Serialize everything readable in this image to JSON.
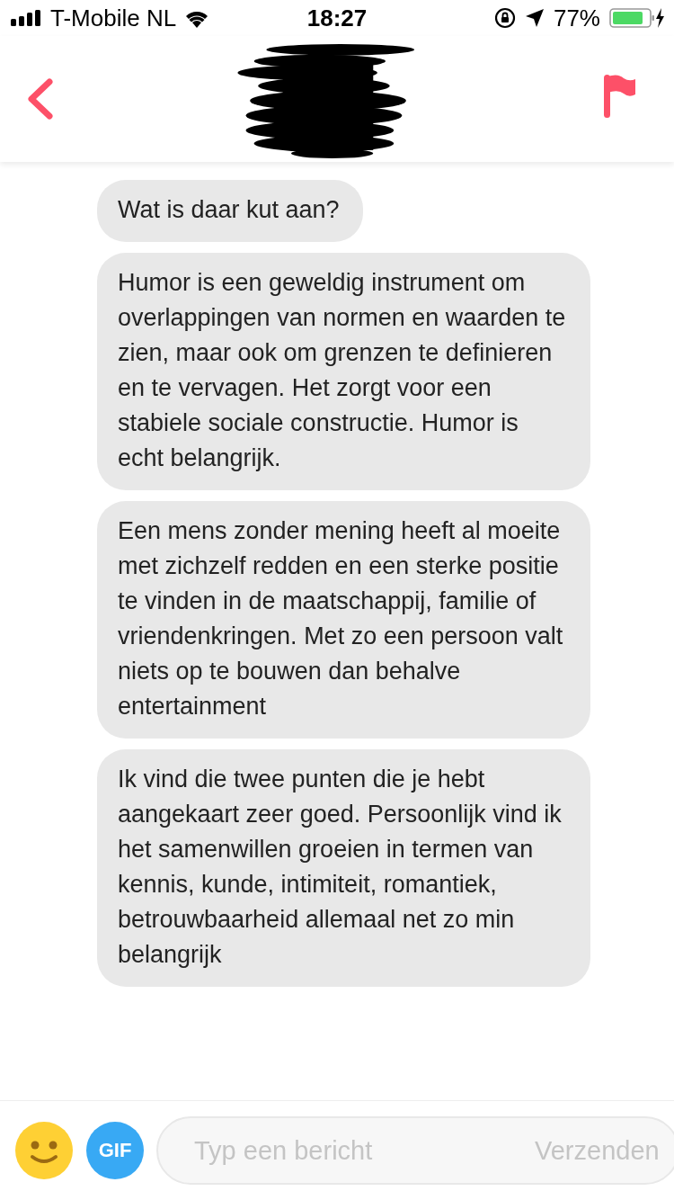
{
  "status_bar": {
    "carrier": "T-Mobile NL",
    "time": "18:27",
    "battery_percent": "77%"
  },
  "messages": [
    {
      "text": "Wat is daar kut aan?"
    },
    {
      "text": "Humor is een geweldig instrument om overlappingen van normen en waarden te zien, maar ook om grenzen te definieren en te vervagen. Het zorgt voor een stabiele sociale constructie. Humor is echt belangrijk."
    },
    {
      "text": "Een mens zonder mening heeft al moeite met zichzelf redden en een sterke positie te vinden in de maatschappij, familie of vriendenkringen. Met zo een persoon valt niets op te bouwen dan behalve entertainment"
    },
    {
      "text": "Ik vind die twee punten die je hebt aangekaart zeer goed. Persoonlijk vind ik het samenwillen groeien in termen van kennis, kunde, intimiteit, romantiek, betrouwbaarheid allemaal net zo min belangrijk"
    }
  ],
  "composer": {
    "gif_label": "GIF",
    "placeholder": "Typ een bericht",
    "send_label": "Verzenden"
  }
}
